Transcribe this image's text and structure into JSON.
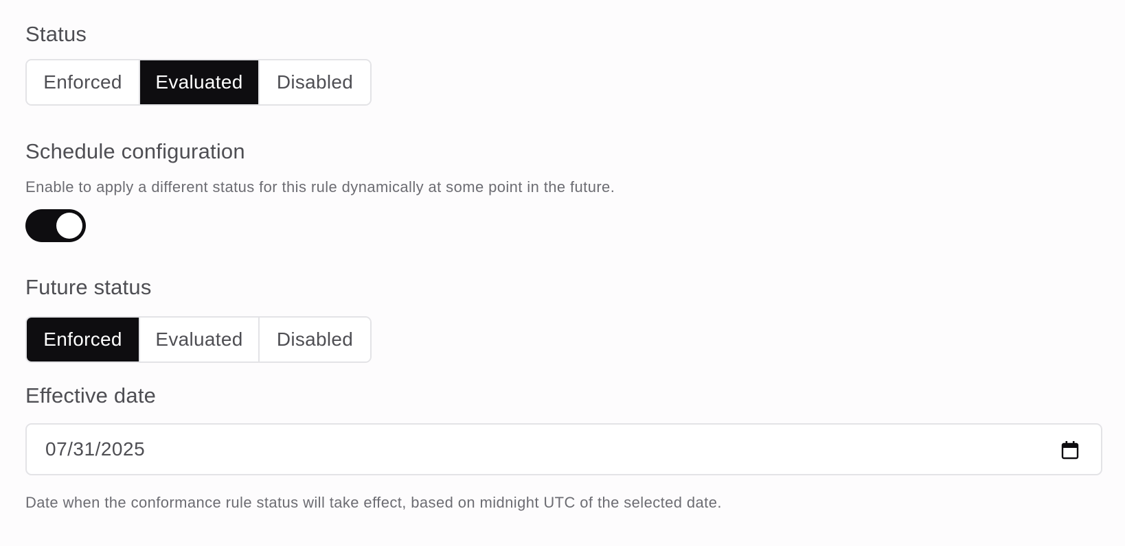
{
  "status": {
    "title": "Status",
    "options": [
      "Enforced",
      "Evaluated",
      "Disabled"
    ],
    "selected": "Evaluated"
  },
  "schedule": {
    "title": "Schedule configuration",
    "description": "Enable to apply a different status for this rule dynamically at some point in the future.",
    "toggle_on": true
  },
  "future_status": {
    "title": "Future status",
    "options": [
      "Enforced",
      "Evaluated",
      "Disabled"
    ],
    "selected": "Enforced"
  },
  "effective_date": {
    "title": "Effective date",
    "value": "07/31/2025",
    "help": "Date when the conformance rule status will take effect, based on midnight UTC of the selected date."
  },
  "icons": {
    "calendar": "calendar-icon"
  },
  "colors": {
    "selected_bg": "#0e0d10",
    "toggle_on": "#0e0d10",
    "border": "#e3e3e6"
  }
}
